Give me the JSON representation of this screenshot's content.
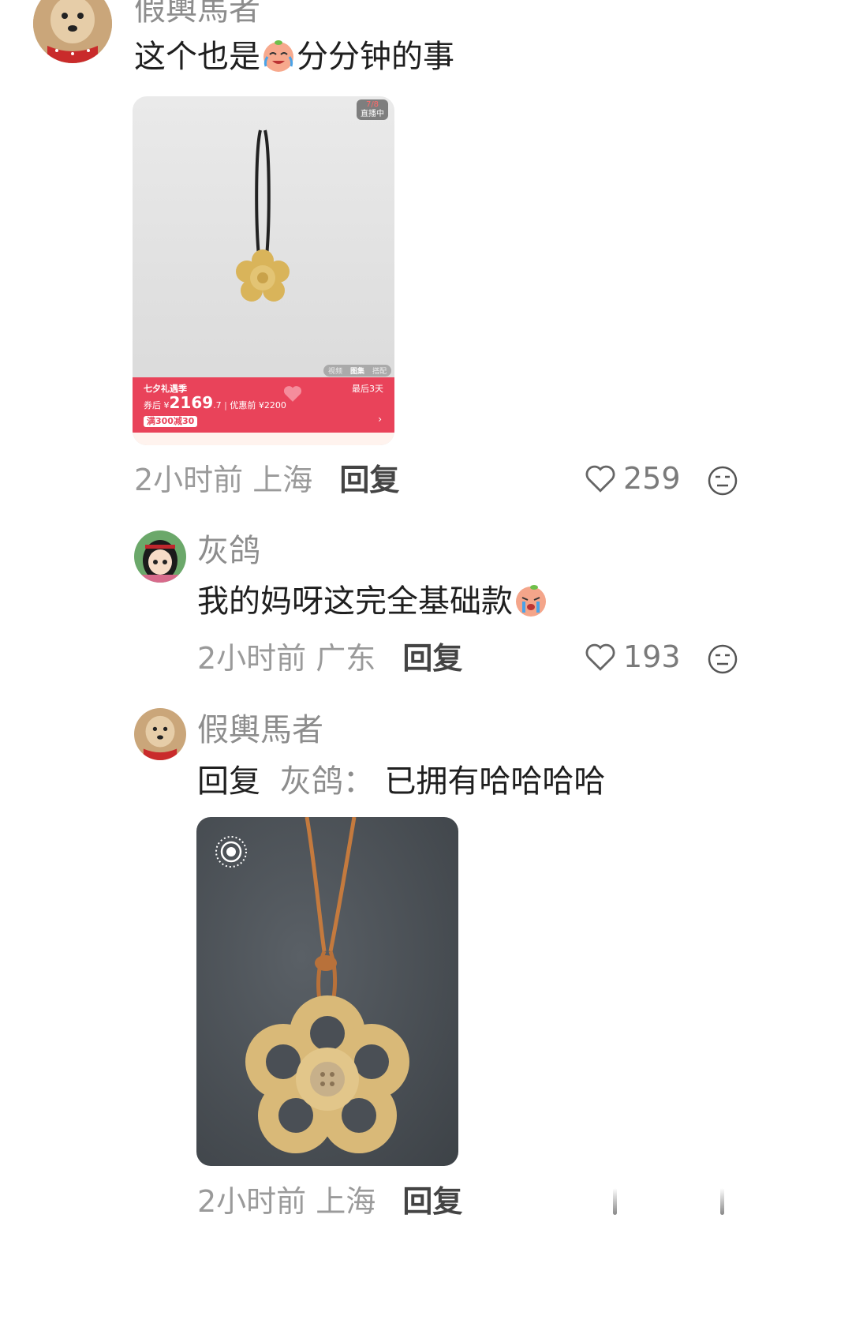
{
  "comments": [
    {
      "username": "假輿馬者",
      "text_before": "这个也是",
      "text_after": "分分钟的事",
      "emoji": "crying-laughing-peach-emoji",
      "image": {
        "badge": "7/8",
        "badge_sub": "直播中",
        "tabs": [
          "视频",
          "图集",
          "搭配"
        ],
        "promo_title": "七夕礼遇季",
        "coupon_label": "券后",
        "currency": "¥",
        "price_main": "2169",
        "price_decimal": ".7",
        "original_label": "优惠前",
        "original_price": "¥2200",
        "days_left": "最后3天",
        "discount": "满300减30"
      },
      "time": "2小时前",
      "location": "上海",
      "reply_label": "回复",
      "likes": "259"
    },
    {
      "username": "灰鸽",
      "text_before": "我的妈呀这完全基础款",
      "emoji": "crying-peach-emoji",
      "time": "2小时前",
      "location": "广东",
      "reply_label": "回复",
      "likes": "193"
    },
    {
      "username": "假輿馬者",
      "reply_prefix": "回复",
      "reply_to": "灰鸽",
      "colon": "：",
      "text": "已拥有哈哈哈哈",
      "time": "2小时前",
      "location": "上海",
      "reply_label": "回复"
    }
  ],
  "colors": {
    "promo_red": "#e9435a",
    "username_gray": "#8d8d8d",
    "text_dark": "#1f1f1f",
    "photo_bg": "#4a4f55",
    "crochet_yellow": "#d9b978"
  }
}
